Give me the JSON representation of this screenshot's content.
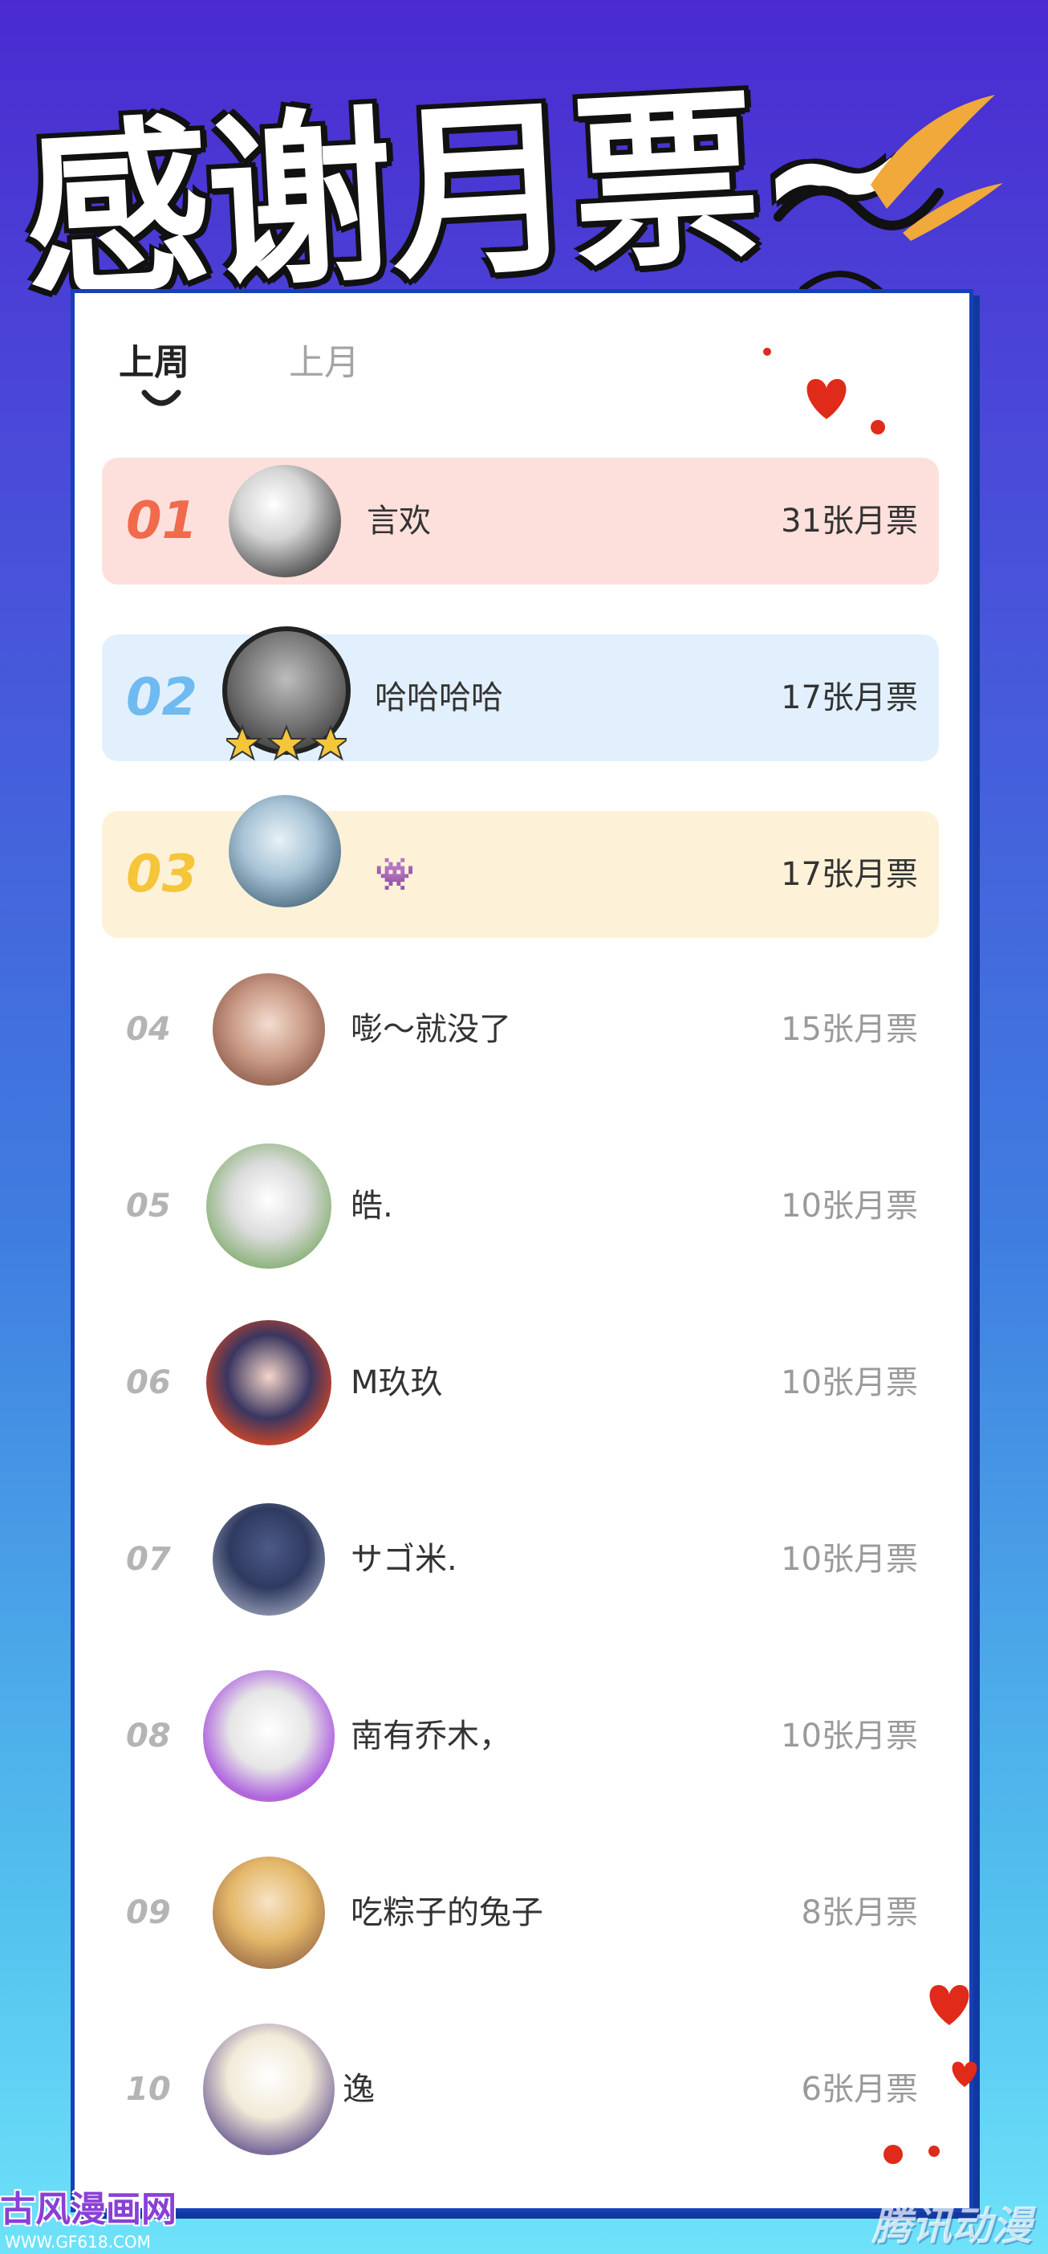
{
  "header": {
    "title": "感谢月票~"
  },
  "tabs": [
    {
      "label": "上周",
      "active": true
    },
    {
      "label": "上月",
      "active": false
    }
  ],
  "ranking": [
    {
      "rank": "01",
      "name": "言欢",
      "votes": "31张月票",
      "highlight": "#fde0dc",
      "rank_color": "#f06a4c"
    },
    {
      "rank": "02",
      "name": "哈哈哈哈",
      "votes": "17张月票",
      "highlight": "#e2f0fd",
      "rank_color": "#6fbaf0"
    },
    {
      "rank": "03",
      "name": "👾",
      "votes": "17张月票",
      "highlight": "#fdf2d8",
      "rank_color": "#f5c53a"
    },
    {
      "rank": "04",
      "name": "嘭～就没了",
      "votes": "15张月票"
    },
    {
      "rank": "05",
      "name": "皓.",
      "votes": "10张月票"
    },
    {
      "rank": "06",
      "name": "M玖玖",
      "votes": "10张月票"
    },
    {
      "rank": "07",
      "name": "サゴ米.",
      "votes": "10张月票"
    },
    {
      "rank": "08",
      "name": "南有乔木，",
      "votes": "10张月票"
    },
    {
      "rank": "09",
      "name": "吃粽子的兔子",
      "votes": "8张月票"
    },
    {
      "rank": "10",
      "name": "逸",
      "votes": "6张月票"
    }
  ],
  "watermarks": {
    "left": "古风漫画网",
    "left_sub": "WWW.GF618.COM",
    "right": "腾讯动漫"
  },
  "colors": {
    "card_border": "#1640b5",
    "accent_orange": "#f0a93a",
    "heart_red": "#e02a1a"
  }
}
